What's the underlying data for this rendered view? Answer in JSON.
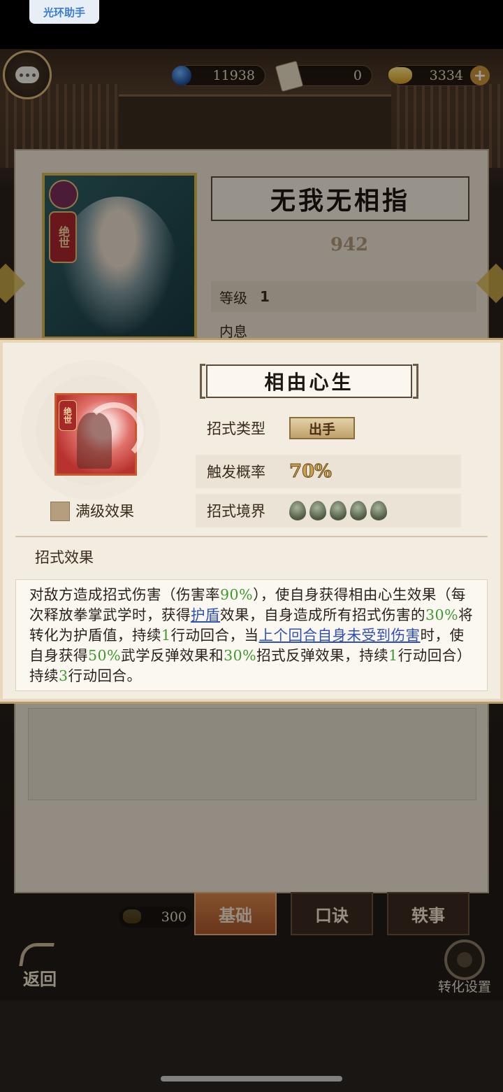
{
  "status_bar": {
    "helper_label": "光环助手"
  },
  "currency": {
    "globe": "11938",
    "scroll": "0",
    "gold": "3334",
    "plus": "+"
  },
  "book": {
    "name": "无我无相指",
    "tier": "绝世",
    "power": "942",
    "level_label": "等级",
    "level_value": "1",
    "inner_label": "内息"
  },
  "tabs": {
    "basic": "基础",
    "formula": "口诀",
    "story": "轶事"
  },
  "cost": "300",
  "back_label": "返回",
  "convert_label": "转化设置",
  "popup": {
    "skill_name": "相由心生",
    "skill_tier": "绝世",
    "max_level_label": "满级效果",
    "type_label": "招式类型",
    "type_value": "出手",
    "rate_label": "触发概率",
    "rate_value": "70%",
    "realm_label": "招式境界",
    "realm_level": 5,
    "effect_heading": "招式效果",
    "description": {
      "s1": "对敌方造成招式伤害（伤害率",
      "v1": "90%",
      "s2": "），使自身获得相由心生效果（每次释放拳掌武学时，获得",
      "k1": "护盾",
      "s3": "效果，自身造成所有招式伤害的",
      "v2": "30%",
      "s4": "将转化为护盾值，持续",
      "v3": "1",
      "s5": "行动回合，当",
      "k2": "上个回合自身未受到伤害",
      "s6": "时，使自身获得",
      "v4": "50%",
      "s7": "武学反弹效果和",
      "v5": "30%",
      "s8": "招式反弹效果，持续",
      "v6": "1",
      "s9": "行动回合）持续",
      "v7": "3",
      "s10": "行动回合。"
    }
  },
  "colors": {
    "highlight_value": "#3f9a2e",
    "keyword": "#2f4fb5",
    "popup_bg": "#f3ece0"
  }
}
